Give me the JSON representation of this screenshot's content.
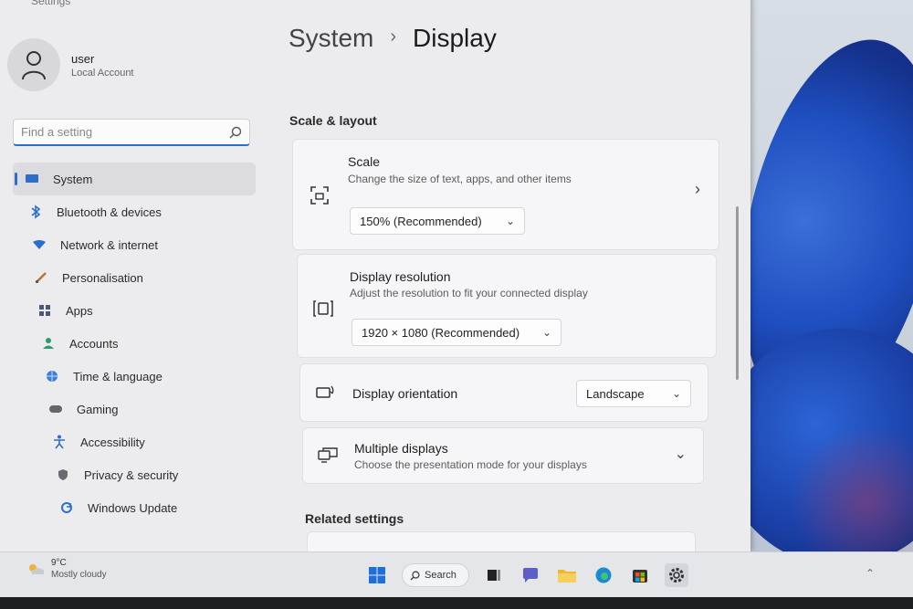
{
  "window": {
    "title": "Settings"
  },
  "account": {
    "name": "user",
    "type": "Local Account"
  },
  "search": {
    "placeholder": "Find a setting"
  },
  "sidebar": {
    "items": [
      {
        "label": "System",
        "icon": "monitor-icon",
        "active": true
      },
      {
        "label": "Bluetooth & devices",
        "icon": "bluetooth-icon",
        "active": false
      },
      {
        "label": "Network & internet",
        "icon": "wifi-icon",
        "active": false
      },
      {
        "label": "Personalisation",
        "icon": "brush-icon",
        "active": false
      },
      {
        "label": "Apps",
        "icon": "apps-icon",
        "active": false
      },
      {
        "label": "Accounts",
        "icon": "person-icon",
        "active": false
      },
      {
        "label": "Time & language",
        "icon": "globe-icon",
        "active": false
      },
      {
        "label": "Gaming",
        "icon": "gamepad-icon",
        "active": false
      },
      {
        "label": "Accessibility",
        "icon": "accessibility-icon",
        "active": false
      },
      {
        "label": "Privacy & security",
        "icon": "shield-icon",
        "active": false
      },
      {
        "label": "Windows Update",
        "icon": "update-icon",
        "active": false
      }
    ]
  },
  "header": {
    "parent": "System",
    "current": "Display"
  },
  "sections": {
    "scale_layout": "Scale & layout",
    "related": "Related settings"
  },
  "scale": {
    "title": "Scale",
    "description": "Change the size of text, apps, and other items",
    "value": "150% (Recommended)"
  },
  "resolution": {
    "title": "Display resolution",
    "description": "Adjust the resolution to fit your connected display",
    "value": "1920 × 1080 (Recommended)"
  },
  "orientation": {
    "title": "Display orientation",
    "value": "Landscape"
  },
  "multiple": {
    "title": "Multiple displays",
    "description": "Choose the presentation mode for your displays"
  },
  "taskbar": {
    "weather_temp": "9°C",
    "weather_condition": "Mostly cloudy",
    "search_label": "Search"
  },
  "colors": {
    "accent": "#2c6ec8",
    "wallpaper": "#1f4fc0"
  }
}
